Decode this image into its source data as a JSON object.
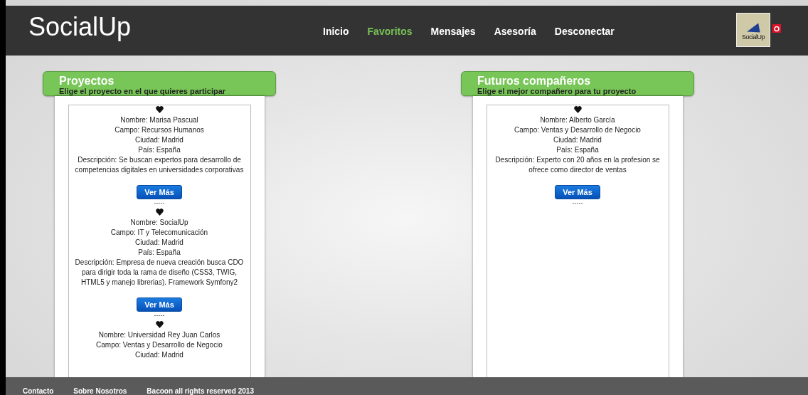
{
  "header": {
    "logo": "SocialUp",
    "nav": [
      {
        "label": "Inicio",
        "selected": false
      },
      {
        "label": "Favoritos",
        "selected": true
      },
      {
        "label": "Mensajes",
        "selected": false
      },
      {
        "label": "Asesoría",
        "selected": false
      },
      {
        "label": "Desconectar",
        "selected": false
      }
    ],
    "avatar_label": "SocialUp"
  },
  "panels": [
    {
      "title": "Proyectos",
      "subtitle": "Elige el proyecto en el que quieres participar",
      "items": [
        {
          "lines": [
            "Nombre: Marisa Pascual",
            "Campo: Recursos Humanos",
            "Ciudad: Madrid",
            "País: España",
            "Descripción: Se buscan expertos para desarrollo de competencias digitales en universidades corporativas"
          ],
          "button": "Ver Más",
          "separator": "-----"
        },
        {
          "lines": [
            "Nombre: SocialUp",
            "Campo: IT y Telecomunicación",
            "Ciudad: Madrid",
            "País: España",
            "Descripción: Empresa de nueva creación busca CDO para dirigir toda la rama de diseño (CSS3, TWIG, HTML5 y manejo librerias). Framework Symfony2"
          ],
          "button": "Ver Más",
          "separator": "-----"
        },
        {
          "lines": [
            "Nombre: Universidad Rey Juan Carlos",
            "Campo: Ventas y Desarrollo de Negocio",
            "Ciudad: Madrid"
          ]
        }
      ]
    },
    {
      "title": "Futuros compañeros",
      "subtitle": "Elige el mejor compañero para tu proyecto",
      "items": [
        {
          "lines": [
            "Nombre: Alberto García",
            "Campo: Ventas y Desarrollo de Negocio",
            "Ciudad: Madrid",
            "País: España",
            "Descripción: Experto con 20 años en la profesion se ofrece como director de ventas"
          ],
          "button": "Ver Más",
          "separator": "-----"
        }
      ]
    }
  ],
  "footer": {
    "links": [
      "Contacto",
      "Sobre Nosotros",
      "Bacoon all rights reserved 2013"
    ]
  }
}
